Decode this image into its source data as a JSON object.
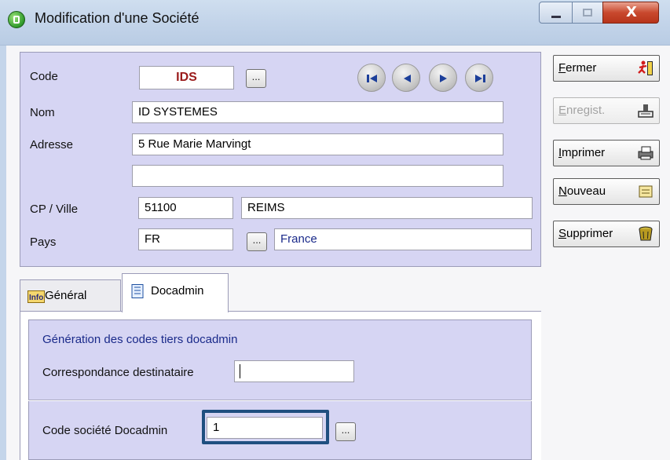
{
  "window": {
    "title": "Modification d'une Société",
    "close_glyph": "X"
  },
  "form": {
    "code": {
      "label": "Code",
      "value": "IDS",
      "browse": "..."
    },
    "nom": {
      "label": "Nom",
      "value": "ID SYSTEMES"
    },
    "adresse": {
      "label": "Adresse",
      "line1": "5 Rue Marie Marvingt",
      "line2": ""
    },
    "cp_ville": {
      "label": "CP / Ville",
      "cp": "51100",
      "ville": "REIMS"
    },
    "pays": {
      "label": "Pays",
      "code": "FR",
      "browse": "...",
      "name": "France"
    },
    "nav_icons": [
      "nav-first-icon",
      "nav-previous-icon",
      "nav-next-icon",
      "nav-last-icon"
    ]
  },
  "actions": [
    {
      "key": "F",
      "rest": "ermer",
      "icon": "running-man-exit-icon",
      "enabled": true
    },
    {
      "key": "E",
      "rest": "nregist.",
      "icon": "save-tray-icon",
      "enabled": false
    },
    {
      "key": "I",
      "rest": "mprimer",
      "icon": "printer-icon",
      "enabled": true
    },
    {
      "key": "N",
      "rest": "ouveau",
      "icon": "new-document-icon",
      "enabled": true
    },
    {
      "key": "S",
      "rest": "upprimer",
      "icon": "trash-can-icon",
      "enabled": true
    }
  ],
  "tabs": [
    {
      "label": "Général",
      "icon": "info-icon",
      "active": false
    },
    {
      "label": "Docadmin",
      "icon": "notebook-icon",
      "active": true
    }
  ],
  "docadmin": {
    "section_title": "Génération des codes tiers docadmin",
    "correspondance": {
      "label": "Correspondance destinataire",
      "value": ""
    },
    "code_societe": {
      "label": "Code société Docadmin",
      "value": "1",
      "browse": "..."
    }
  },
  "colors": {
    "panel_bg": "#d6d5f3",
    "code_text": "#9a1b1b",
    "country_text": "#1a2a8a",
    "highlight_border": "#1f4f80"
  }
}
